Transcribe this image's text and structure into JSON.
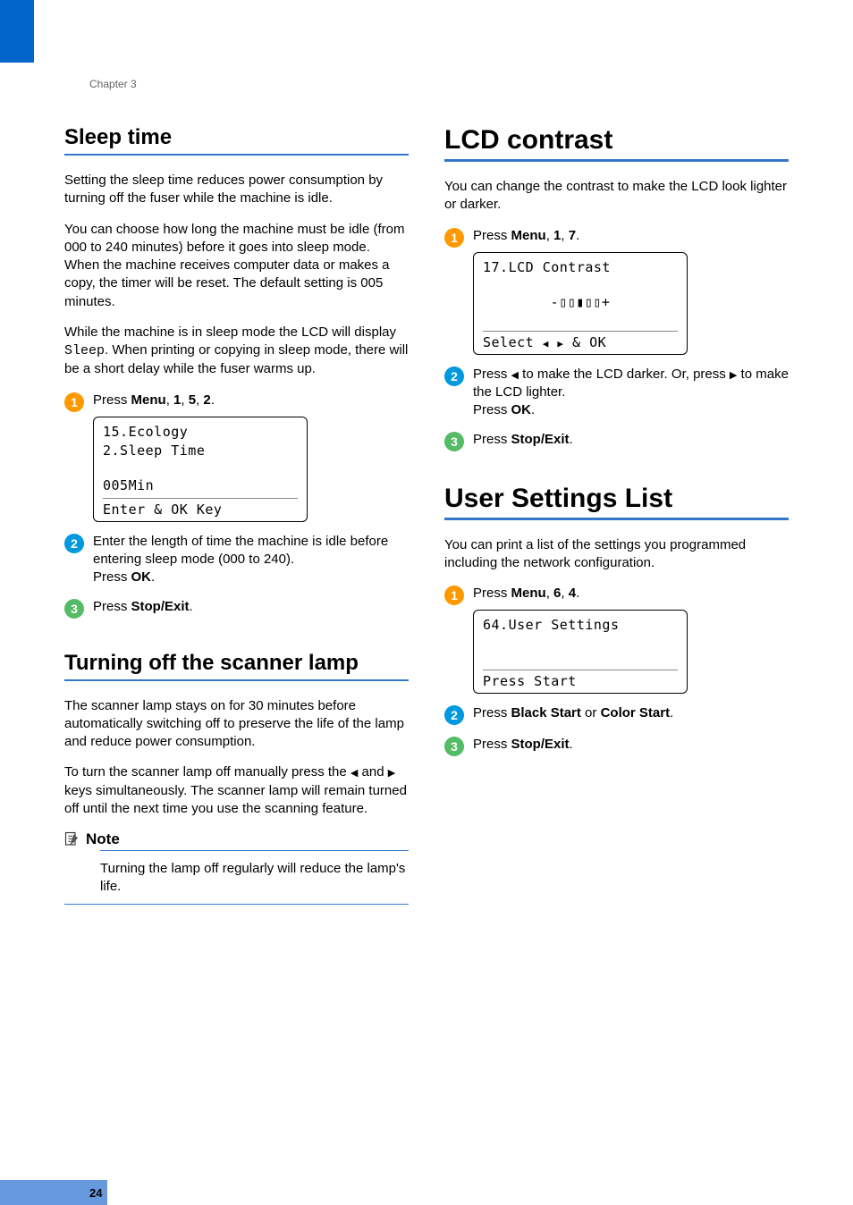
{
  "chapter": "Chapter 3",
  "pageNumber": "24",
  "left": {
    "sleepTime": {
      "heading": "Sleep time",
      "para1": "Setting the sleep time reduces power consumption by turning off the fuser while the machine is idle.",
      "para2": "You can choose how long the machine must be idle (from 000 to 240 minutes) before it goes into sleep mode. When the machine receives computer data or makes a copy, the timer will be reset. The default setting is 005 minutes.",
      "para3_a": "While the machine is in sleep mode the LCD will display ",
      "para3_mono": "Sleep",
      "para3_b": ". When printing or copying in sleep mode, there will be a short delay while the fuser warms up.",
      "step1_a": "Press ",
      "step1_menu": "Menu",
      "step1_b": ", ",
      "step1_n1": "1",
      "step1_c": ", ",
      "step1_n2": "5",
      "step1_d": ", ",
      "step1_n3": "2",
      "step1_e": ".",
      "lcd": {
        "l1": "15.Ecology",
        "l2": "  2.Sleep Time",
        "l3": "  005Min",
        "l4": "Enter & OK Key"
      },
      "step2_a": "Enter the length of time the machine is idle before entering sleep mode (000 to 240).",
      "step2_b": "Press ",
      "step2_ok": "OK",
      "step2_c": ".",
      "step3_a": "Press ",
      "step3_stop": "Stop/Exit",
      "step3_b": "."
    },
    "scannerLamp": {
      "heading": "Turning off the scanner lamp",
      "para1": "The scanner lamp stays on for 30 minutes before automatically switching off to preserve the life of the lamp and reduce power consumption.",
      "para2_a": "To turn the scanner lamp off manually press the ",
      "para2_b": " and ",
      "para2_c": " keys simultaneously. The scanner lamp will remain turned off until the next time you use the scanning feature.",
      "noteLabel": "Note",
      "noteBody": "Turning the lamp off regularly will reduce the lamp's life."
    }
  },
  "right": {
    "lcdContrast": {
      "heading": "LCD contrast",
      "para1": "You can change the contrast to make the LCD look lighter or darker.",
      "step1_a": "Press ",
      "step1_menu": "Menu",
      "step1_b": ", ",
      "step1_n1": "1",
      "step1_c": ", ",
      "step1_n2": "7",
      "step1_d": ".",
      "lcd": {
        "l1": "17.LCD Contrast",
        "l2": "-▯▯▮▯▯+",
        "l4_a": "Select ",
        "l4_b": " & OK"
      },
      "step2_a": "Press ",
      "step2_b": " to make the LCD darker. Or, press ",
      "step2_c": " to make the LCD lighter.",
      "step2_d": "Press ",
      "step2_ok": "OK",
      "step2_e": ".",
      "step3_a": "Press ",
      "step3_stop": "Stop/Exit",
      "step3_b": "."
    },
    "userSettings": {
      "heading": "User Settings List",
      "para1": "You can print a list of the settings you programmed including the network configuration.",
      "step1_a": "Press ",
      "step1_menu": "Menu",
      "step1_b": ", ",
      "step1_n1": "6",
      "step1_c": ", ",
      "step1_n2": "4",
      "step1_d": ".",
      "lcd": {
        "l1": "64.User Settings",
        "l4": "Press Start"
      },
      "step2_a": "Press ",
      "step2_black": "Black Start",
      "step2_b": " or ",
      "step2_color": "Color Start",
      "step2_c": ".",
      "step3_a": "Press ",
      "step3_stop": "Stop/Exit",
      "step3_b": "."
    }
  }
}
